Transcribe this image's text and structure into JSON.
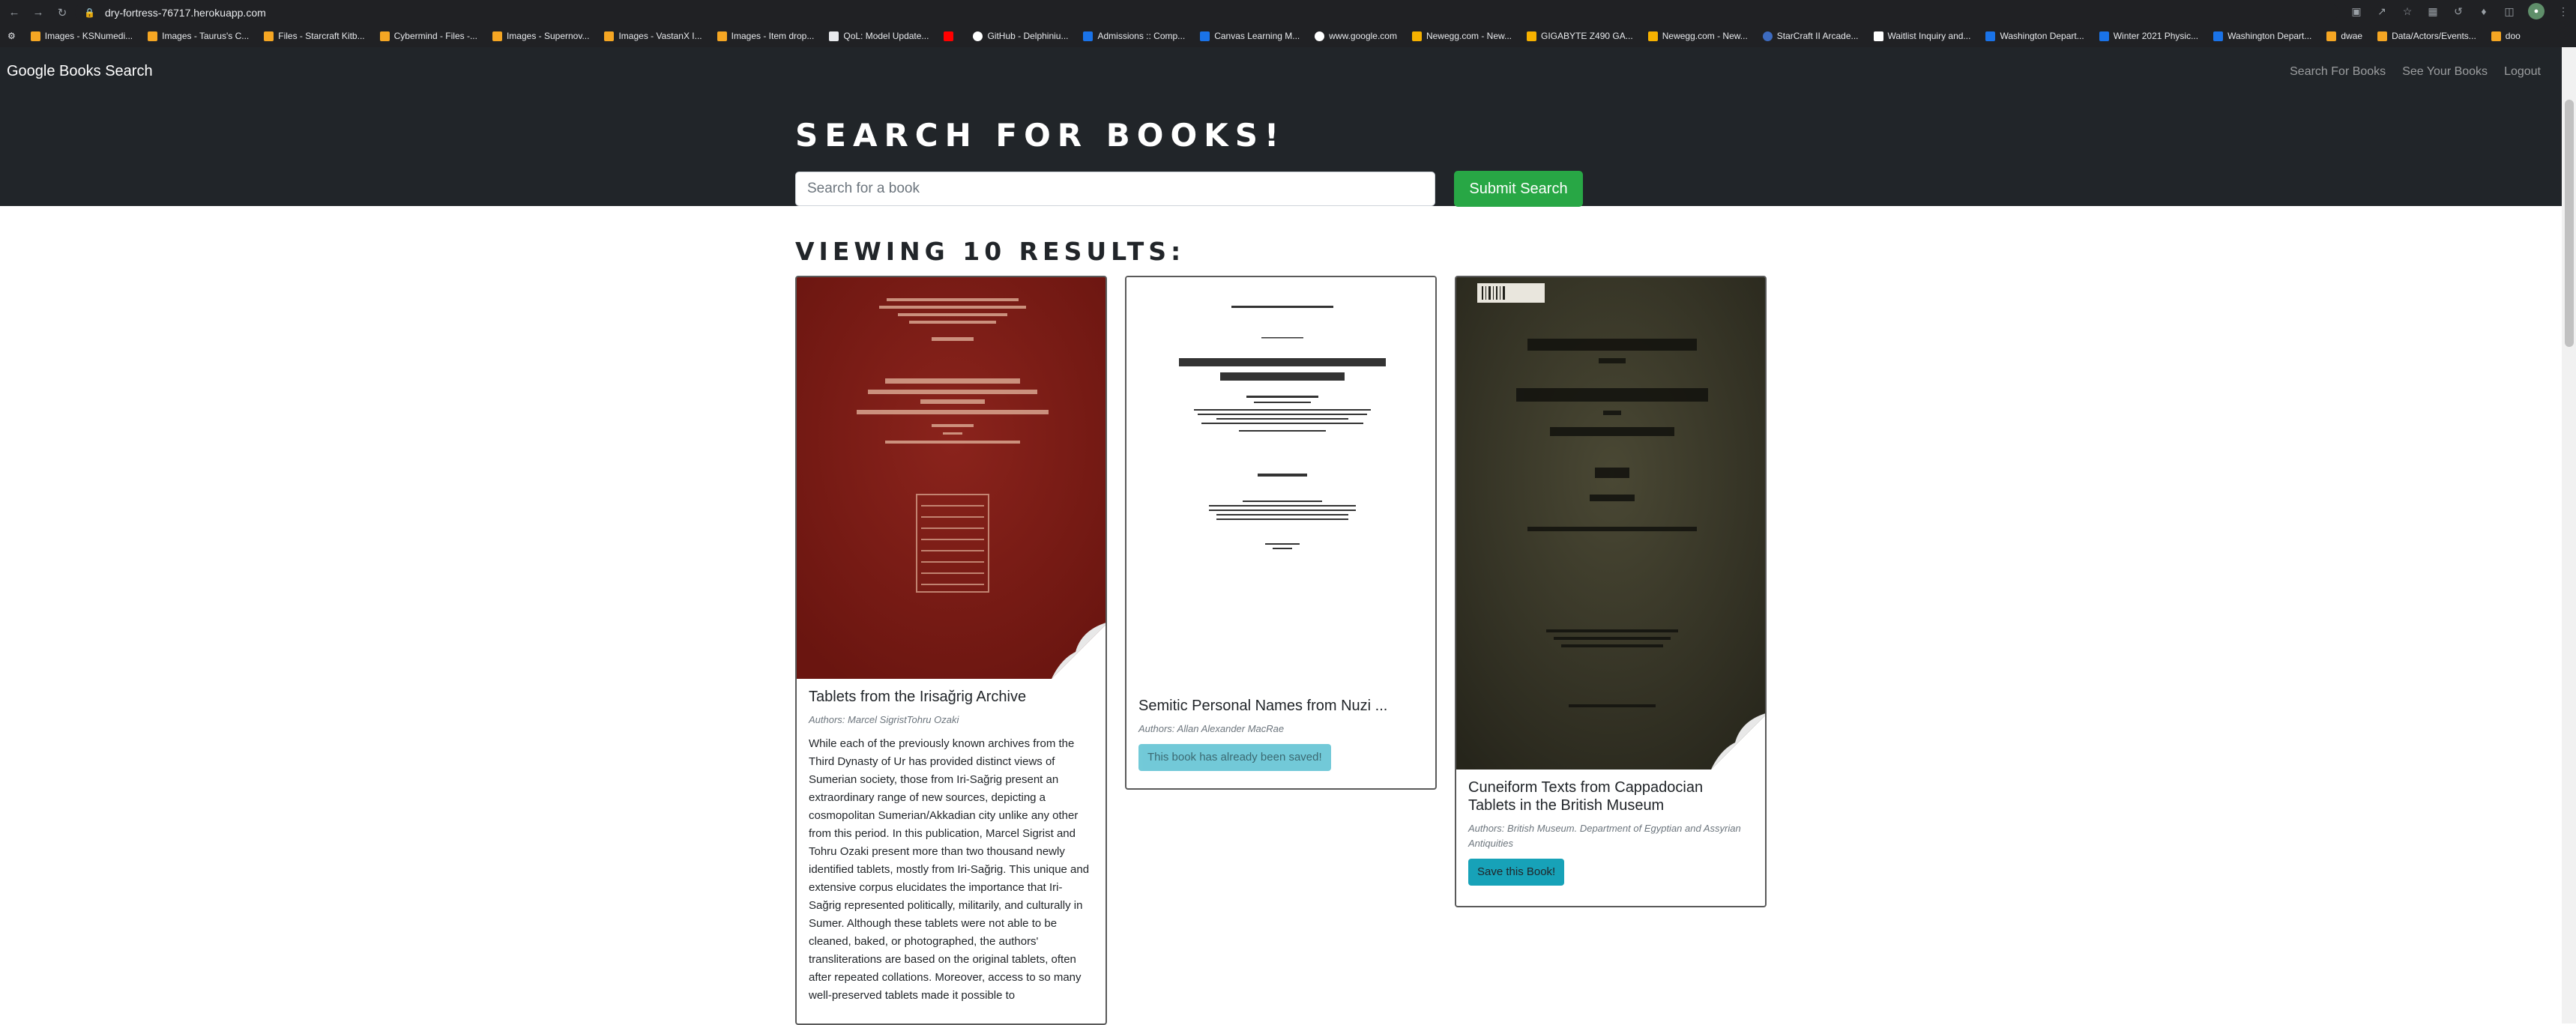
{
  "browser": {
    "url": "dry-fortress-76717.herokuapp.com",
    "bookmarks": [
      {
        "label": "Images - KSNumedi...",
        "icon": "bing"
      },
      {
        "label": "Images - Taurus's C...",
        "icon": "bing"
      },
      {
        "label": "Files - Starcraft Kitb...",
        "icon": "bing"
      },
      {
        "label": "Cybermind - Files -...",
        "icon": "bing"
      },
      {
        "label": "Images - Supernov...",
        "icon": "bing"
      },
      {
        "label": "Images - VastanX I...",
        "icon": "bing"
      },
      {
        "label": "Images - Item drop...",
        "icon": "bing"
      },
      {
        "label": "QoL: Model Update...",
        "icon": "n"
      },
      {
        "label": "",
        "icon": "yt"
      },
      {
        "label": "GitHub - Delphiniu...",
        "icon": "gh"
      },
      {
        "label": "Admissions :: Comp...",
        "icon": "b"
      },
      {
        "label": "Canvas Learning M...",
        "icon": "b"
      },
      {
        "label": "www.google.com",
        "icon": "g"
      },
      {
        "label": "Newegg.com - New...",
        "icon": "ne"
      },
      {
        "label": "GIGABYTE Z490 GA...",
        "icon": "ne"
      },
      {
        "label": "Newegg.com - New...",
        "icon": "ne"
      },
      {
        "label": "StarCraft II Arcade...",
        "icon": "sc"
      },
      {
        "label": "Waitlist Inquiry and...",
        "icon": "w"
      },
      {
        "label": "Washington Depart...",
        "icon": "b"
      },
      {
        "label": "Winter 2021 Physic...",
        "icon": "b"
      },
      {
        "label": "Washington Depart...",
        "icon": "b"
      },
      {
        "label": "dwae",
        "icon": "bing"
      },
      {
        "label": "Data/Actors/Events...",
        "icon": "bing"
      },
      {
        "label": "doo",
        "icon": "bing"
      }
    ]
  },
  "navbar": {
    "brand": "Google Books Search",
    "links": [
      "Search For Books",
      "See Your Books",
      "Logout"
    ]
  },
  "hero": {
    "title": "Search for Books!",
    "search_placeholder": "Search for a book",
    "submit_label": "Submit Search"
  },
  "results": {
    "heading": "Viewing 10 results:",
    "books": [
      {
        "title": "Tablets from the Irisağrig Archive",
        "authors": "Authors: Marcel SigristTohru Ozaki",
        "description": "While each of the previously known archives from the Third Dynasty of Ur has provided distinct views of Sumerian society, those from Iri-Sağrig present an extraordinary range of new sources, depicting a cosmopolitan Sumerian/Akkadian city unlike any other from this period. In this publication, Marcel Sigrist and Tohru Ozaki present more than two thousand newly identified tablets, mostly from Iri-Sağrig. This unique and extensive corpus elucidates the importance that Iri-Sağrig represented politically, militarily, and culturally in Sumer. Although these tablets were not able to be cleaned, baked, or photographed, the authors' transliterations are based on the original tablets, often after repeated collations. Moreover, access to so many well-preserved tablets made it possible to",
        "button": ""
      },
      {
        "title": "Semitic Personal Names from Nuzi ...",
        "authors": "Authors: Allan Alexander MacRae",
        "description": "",
        "button": "This book has already been saved!"
      },
      {
        "title": "Cuneiform Texts from Cappadocian Tablets in the British Museum",
        "authors": "Authors: British Museum. Department of Egyptian and Assyrian Antiquities",
        "description": "",
        "button": "Save this Book!"
      }
    ]
  }
}
